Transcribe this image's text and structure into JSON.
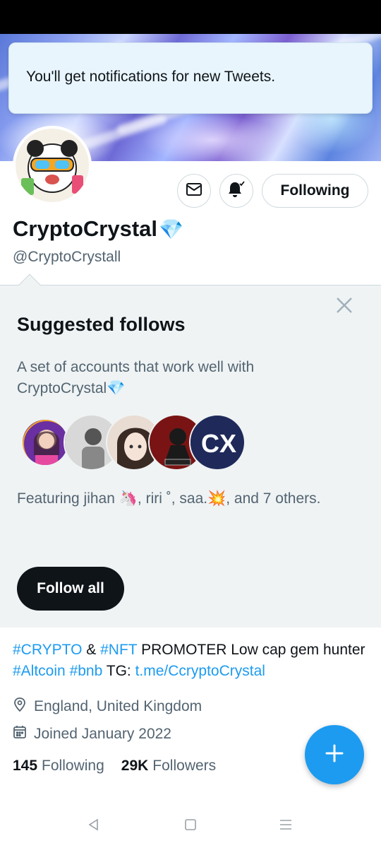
{
  "toast": {
    "message": "You'll get notifications for new Tweets."
  },
  "profile": {
    "name": "CryptoCrystal",
    "name_emoji": "💎",
    "handle": "@CryptoCrystall",
    "following_button": "Following"
  },
  "suggested": {
    "title": "Suggested follows",
    "description": "A set of accounts that work well with CryptoCrystal💎",
    "featuring": "Featuring jihan 🦄, riri ˚, saa.💥, and 7 others.",
    "follow_all": "Follow all"
  },
  "bio": {
    "part1_link": "#CRYPTO",
    "part2": " & ",
    "part3_link": "#NFT",
    "part4": " PROMOTER Low cap gem hunter ",
    "part5_link": "#Altcoin",
    "part6": " ",
    "part7_link": "#bnb",
    "part8": " TG: ",
    "part9_link": "t.me/CcryptoCrystal"
  },
  "meta": {
    "location": "England, United Kingdom",
    "joined": "Joined January 2022"
  },
  "counts": {
    "following_value": "145",
    "following_label": "Following",
    "followers_value": "29K",
    "followers_label": "Followers"
  },
  "colors": {
    "accent": "#1d9bf0",
    "text_primary": "#0f1419",
    "text_secondary": "#536471",
    "suggest_bg": "#eff3f4",
    "toast_bg": "#e8f5fd"
  },
  "icons": {
    "message": "envelope-icon",
    "notify": "bell-check-icon",
    "close": "close-icon",
    "location": "location-pin-icon",
    "calendar": "calendar-icon",
    "compose": "plus-icon"
  }
}
